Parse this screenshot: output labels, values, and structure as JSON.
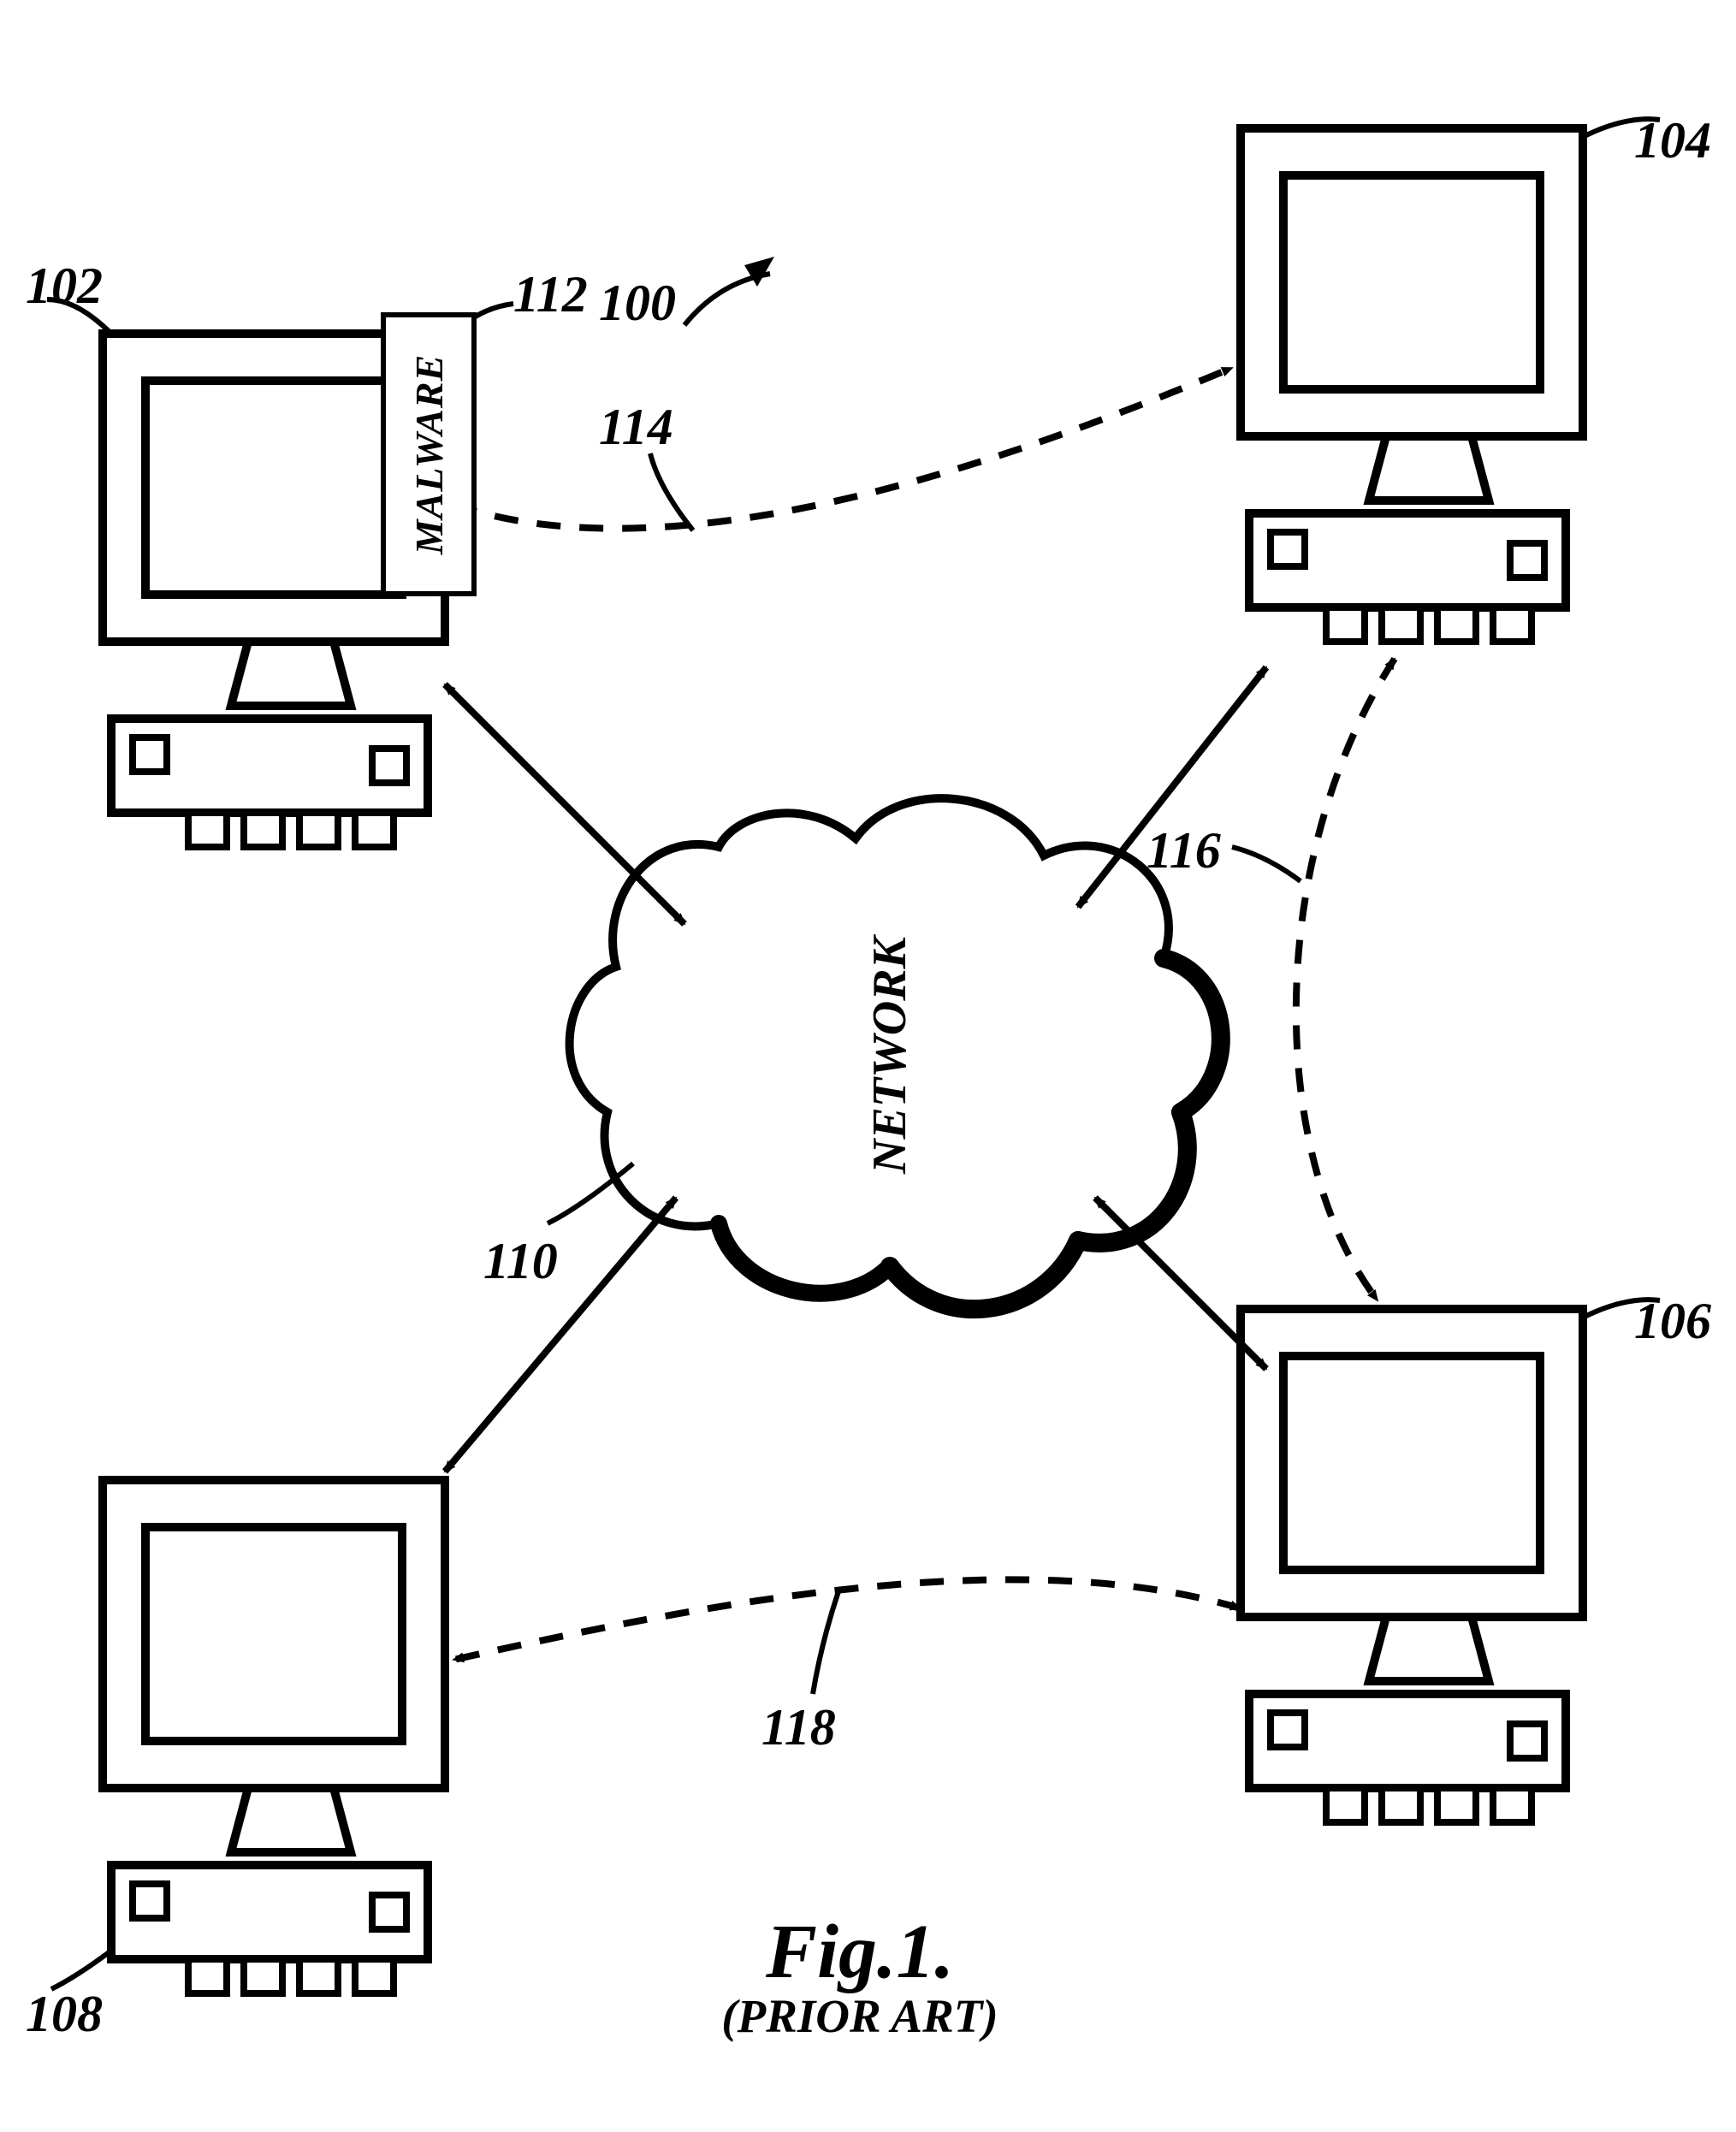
{
  "figure": {
    "number_label": "Fig.1.",
    "subtitle": "(PRIOR ART)"
  },
  "labels": {
    "ref_100": "100",
    "ref_102": "102",
    "ref_104": "104",
    "ref_106": "106",
    "ref_108": "108",
    "ref_110": "110",
    "ref_112": "112",
    "ref_114": "114",
    "ref_116": "116",
    "ref_118": "118"
  },
  "nodes": {
    "network_label": "NETWORK",
    "malware_label": "MALWARE"
  }
}
